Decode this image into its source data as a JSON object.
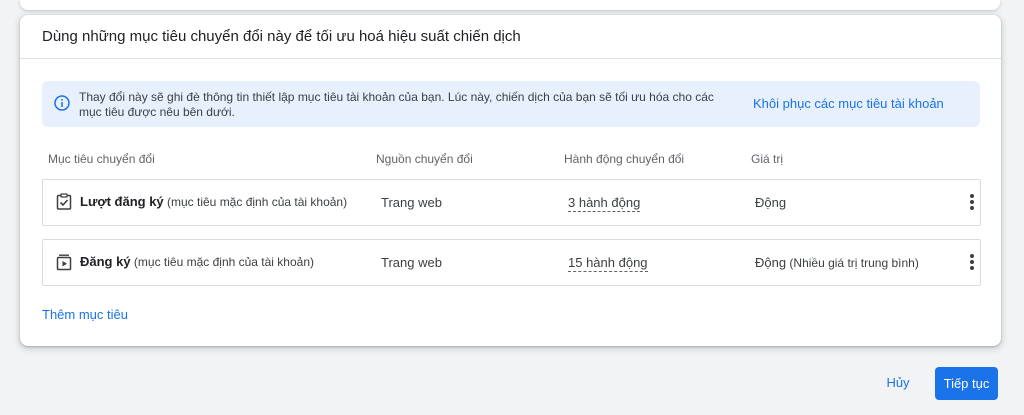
{
  "card": {
    "title": "Dùng những mục tiêu chuyển đổi này để tối ưu hoá hiệu suất chiến dịch"
  },
  "banner": {
    "icon": "info-icon",
    "text": "Thay đổi này sẽ ghi đè thông tin thiết lập mục tiêu tài khoản của bạn. Lúc này, chiến dịch của bạn sẽ tối ưu hóa cho các mục tiêu được nêu bên dưới.",
    "link": "Khôi phục các mục tiêu tài khoản"
  },
  "table": {
    "headers": {
      "goal": "Mục tiêu chuyển đổi",
      "source": "Nguồn chuyển đổi",
      "actions": "Hành động chuyển đổi",
      "value": "Giá trị"
    },
    "rows": [
      {
        "icon": "clipboard-check-icon",
        "name": "Lượt đăng ký",
        "note": " (mục tiêu mặc định của tài khoản)",
        "source": "Trang web",
        "actions": "3 hành động",
        "value": "Động",
        "value_note": ""
      },
      {
        "icon": "video-play-icon",
        "name": "Đăng ký",
        "note": " (mục tiêu mặc định của tài khoản)",
        "source": "Trang web",
        "actions": "15 hành động",
        "value": "Động",
        "value_note": " (Nhiều giá trị trung bình)"
      }
    ]
  },
  "add_goal": "Thêm mục tiêu",
  "footer": {
    "cancel": "Hủy",
    "continue": "Tiếp tục"
  },
  "colors": {
    "accent": "#1a73e8",
    "banner_bg": "#e8f0fe",
    "page_bg": "#f1f3f4"
  }
}
